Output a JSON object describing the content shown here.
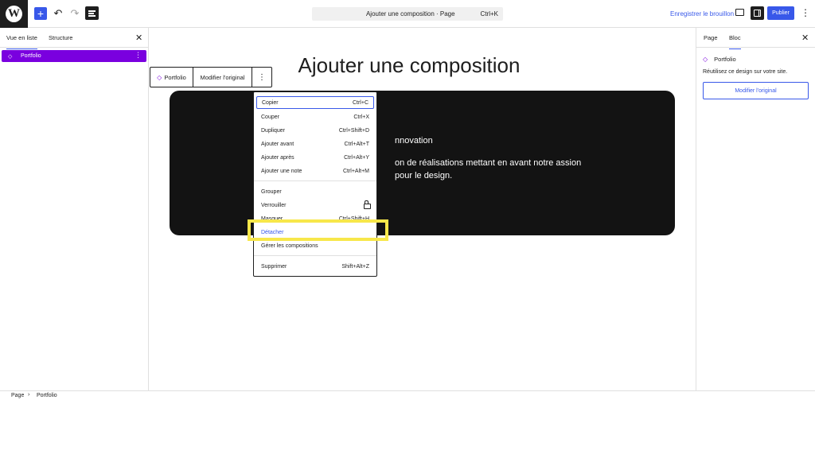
{
  "topbar": {
    "logo": "W",
    "add_icon": "+",
    "undo_icon": "↶",
    "redo_icon": "↷",
    "command_title": "Ajouter une composition · Page",
    "command_shortcut": "Ctrl+K",
    "save_draft": "Enregistrer le brouillon",
    "publish": "Publier",
    "more_icon": "⋮"
  },
  "left_panel": {
    "tabs": [
      {
        "label": "Vue en liste",
        "active": true
      },
      {
        "label": "Structure",
        "active": false
      }
    ],
    "close_icon": "✕",
    "list_item": {
      "label": "Portfolio",
      "icon": "◇",
      "dots": "⋮"
    }
  },
  "canvas": {
    "heading": "Ajouter une composition",
    "block_toolbar": {
      "pattern_icon": "◇",
      "pattern_label": "Portfolio",
      "edit_original": "Modifier l'original",
      "options_icon": "⋮"
    },
    "dark_block": {
      "heading": "nnovation",
      "text": "on de réalisations mettant en avant notre assion pour le design."
    }
  },
  "menu": {
    "group1": [
      {
        "label": "Copier",
        "shortcut": "Ctrl+C"
      },
      {
        "label": "Couper",
        "shortcut": "Ctrl+X"
      },
      {
        "label": "Dupliquer",
        "shortcut": "Ctrl+Shift+D"
      },
      {
        "label": "Ajouter avant",
        "shortcut": "Ctrl+Alt+T"
      },
      {
        "label": "Ajouter après",
        "shortcut": "Ctrl+Alt+Y"
      },
      {
        "label": "Ajouter une note",
        "shortcut": "Ctrl+Alt+M"
      }
    ],
    "group2": [
      {
        "label": "Grouper",
        "shortcut": ""
      },
      {
        "label": "Verrouiller",
        "shortcut": ""
      },
      {
        "label": "Masquer",
        "shortcut": "Ctrl+Shift+H"
      },
      {
        "label": "Détacher",
        "shortcut": ""
      },
      {
        "label": "Gérer les compositions",
        "shortcut": ""
      }
    ],
    "group3": [
      {
        "label": "Supprimer",
        "shortcut": "Shift+Alt+Z"
      }
    ]
  },
  "right_panel": {
    "tabs": [
      {
        "label": "Page",
        "active": false
      },
      {
        "label": "Bloc",
        "active": true
      }
    ],
    "close_icon": "✕",
    "block_icon": "◇",
    "block_name": "Portfolio",
    "description": "Réutilisez ce design sur votre site.",
    "edit_original": "Modifier l'original"
  },
  "footer": {
    "breadcrumb": [
      "Page",
      "Portfolio"
    ],
    "separator": "›"
  },
  "colors": {
    "accent": "#3858e9",
    "pattern": "#7a00df",
    "highlight": "#f7e74a"
  }
}
